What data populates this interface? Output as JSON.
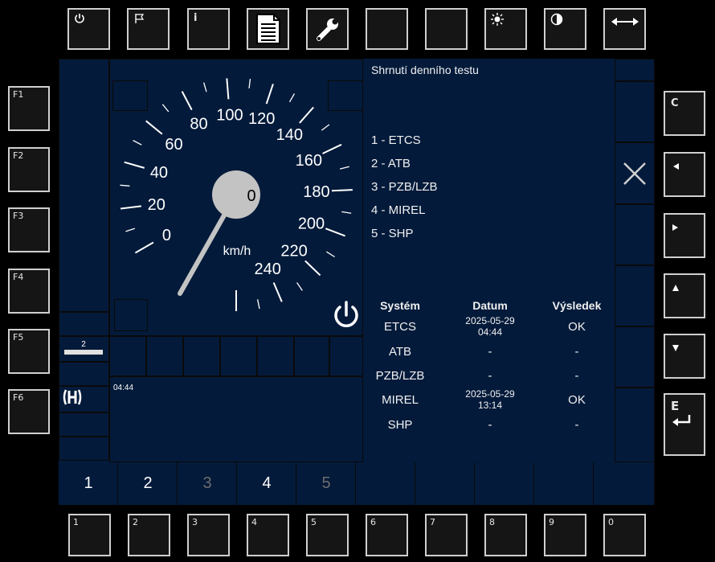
{
  "top_buttons": [
    {
      "name": "power-button",
      "icon": "power-icon"
    },
    {
      "name": "flag-button",
      "icon": "flag-icon"
    },
    {
      "name": "info-button",
      "icon": "info-icon",
      "label": "i"
    },
    {
      "name": "document-button",
      "icon": "document-icon"
    },
    {
      "name": "wrench-button",
      "icon": "wrench-icon"
    },
    {
      "name": "blank-button-1"
    },
    {
      "name": "blank-button-2"
    },
    {
      "name": "brightness-button",
      "icon": "sun-icon"
    },
    {
      "name": "contrast-button",
      "icon": "contrast-icon"
    },
    {
      "name": "swap-button",
      "icon": "double-arrow-icon"
    }
  ],
  "left_buttons": [
    "F1",
    "F2",
    "F3",
    "F4",
    "F5",
    "F6"
  ],
  "right_buttons": [
    {
      "label": "C",
      "icon": "clear-icon"
    },
    {
      "icon": "arrow-left-icon"
    },
    {
      "icon": "arrow-right-icon"
    },
    {
      "icon": "arrow-up-icon"
    },
    {
      "icon": "arrow-down-icon"
    },
    {
      "label": "E",
      "icon": "enter-icon"
    }
  ],
  "bottom_buttons": [
    "1",
    "2",
    "3",
    "4",
    "5",
    "6",
    "7",
    "8",
    "9",
    "0"
  ],
  "speedometer": {
    "current_speed": "0",
    "unit": "km/h",
    "scale_labels": [
      "0",
      "20",
      "40",
      "60",
      "80",
      "100",
      "120",
      "140",
      "160",
      "180",
      "200",
      "220",
      "240"
    ]
  },
  "left_strip": {
    "gear_value": "2",
    "time": "04:44"
  },
  "panel": {
    "title": "Shrnutí denního testu",
    "systems": [
      "1 - ETCS",
      "2 - ATB",
      "3 - PZB/LZB",
      "4 - MIREL",
      "5 - SHP"
    ],
    "table": {
      "headers": {
        "system": "Systém",
        "date": "Datum",
        "result": "Výsledek"
      },
      "rows": [
        {
          "system": "ETCS",
          "date": "2025-05-29",
          "time": "04:44",
          "result": "OK"
        },
        {
          "system": "ATB",
          "date": "-",
          "time": "",
          "result": "-"
        },
        {
          "system": "PZB/LZB",
          "date": "-",
          "time": "",
          "result": "-"
        },
        {
          "system": "MIREL",
          "date": "2025-05-29",
          "time": "13:14",
          "result": "OK"
        },
        {
          "system": "SHP",
          "date": "-",
          "time": "",
          "result": "-"
        }
      ]
    }
  },
  "tabs": [
    {
      "label": "1",
      "enabled": true
    },
    {
      "label": "2",
      "enabled": true
    },
    {
      "label": "3",
      "enabled": false
    },
    {
      "label": "4",
      "enabled": true
    },
    {
      "label": "5",
      "enabled": false
    }
  ],
  "colors": {
    "screen_bg": "#031a3a",
    "button_border": "#cfcfcf",
    "disabled_text": "#6d6d6d"
  }
}
